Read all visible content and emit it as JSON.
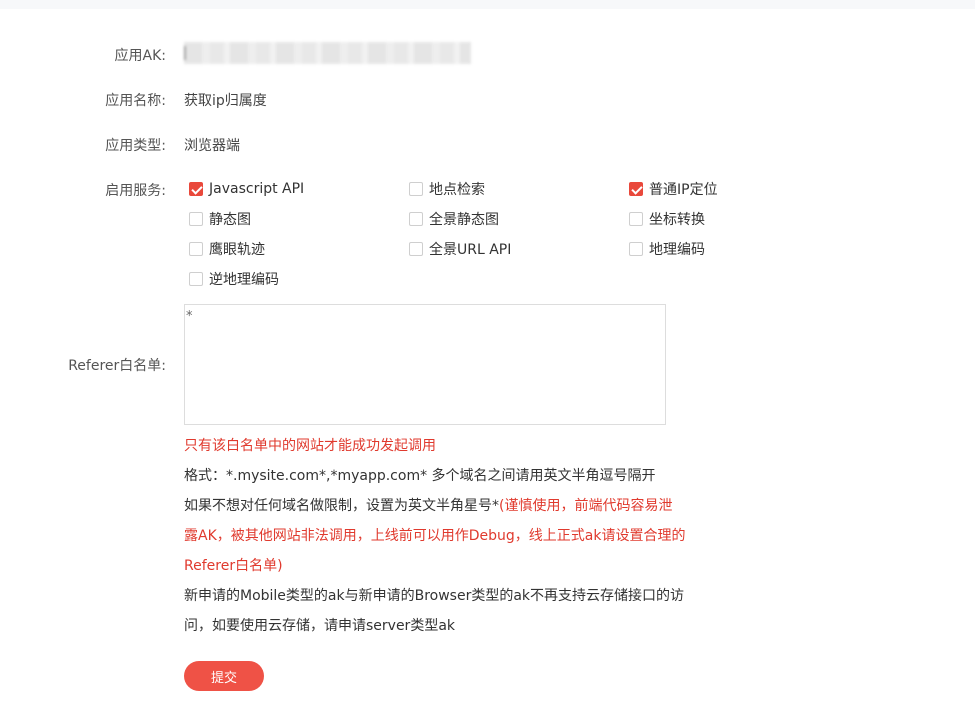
{
  "fields": {
    "ak_label": "应用AK:",
    "name_label": "应用名称:",
    "name_value": "获取ip归属度",
    "type_label": "应用类型:",
    "type_value": "浏览器端",
    "services_label": "启用服务:",
    "referer_label": "Referer白名单:"
  },
  "services": [
    {
      "label": "Javascript API",
      "checked": true
    },
    {
      "label": "地点检索",
      "checked": false
    },
    {
      "label": "普通IP定位",
      "checked": true
    },
    {
      "label": "静态图",
      "checked": false
    },
    {
      "label": "全景静态图",
      "checked": false
    },
    {
      "label": "坐标转换",
      "checked": false
    },
    {
      "label": "鹰眼轨迹",
      "checked": false
    },
    {
      "label": "全景URL API",
      "checked": false
    },
    {
      "label": "地理编码",
      "checked": false
    },
    {
      "label": "逆地理编码",
      "checked": false
    }
  ],
  "referer": {
    "value": "*"
  },
  "notes": {
    "warning": "只有该白名单中的网站才能成功发起调用",
    "format": "格式：*.mysite.com*,*myapp.com* 多个域名之间请用英文半角逗号隔开",
    "star_line1_dark": "如果不想对任何域名做限制，设置为英文半角星号*",
    "star_line1_red": "(谨慎使用，前端代码容易泄",
    "star_line2_red": "露AK，被其他网站非法调用，上线前可以用作Debug，线上正式ak请设置合理的",
    "star_line3_red": "Referer白名单)",
    "mobile_line1": "新申请的Mobile类型的ak与新申请的Browser类型的ak不再支持云存储接口的访",
    "mobile_line2": "问，如要使用云存储，请申请server类型ak"
  },
  "submit_label": "提交",
  "colors": {
    "accent": "#ef5246",
    "warning_text": "#e03a2e",
    "checkbox_checked": "#e9483b"
  }
}
